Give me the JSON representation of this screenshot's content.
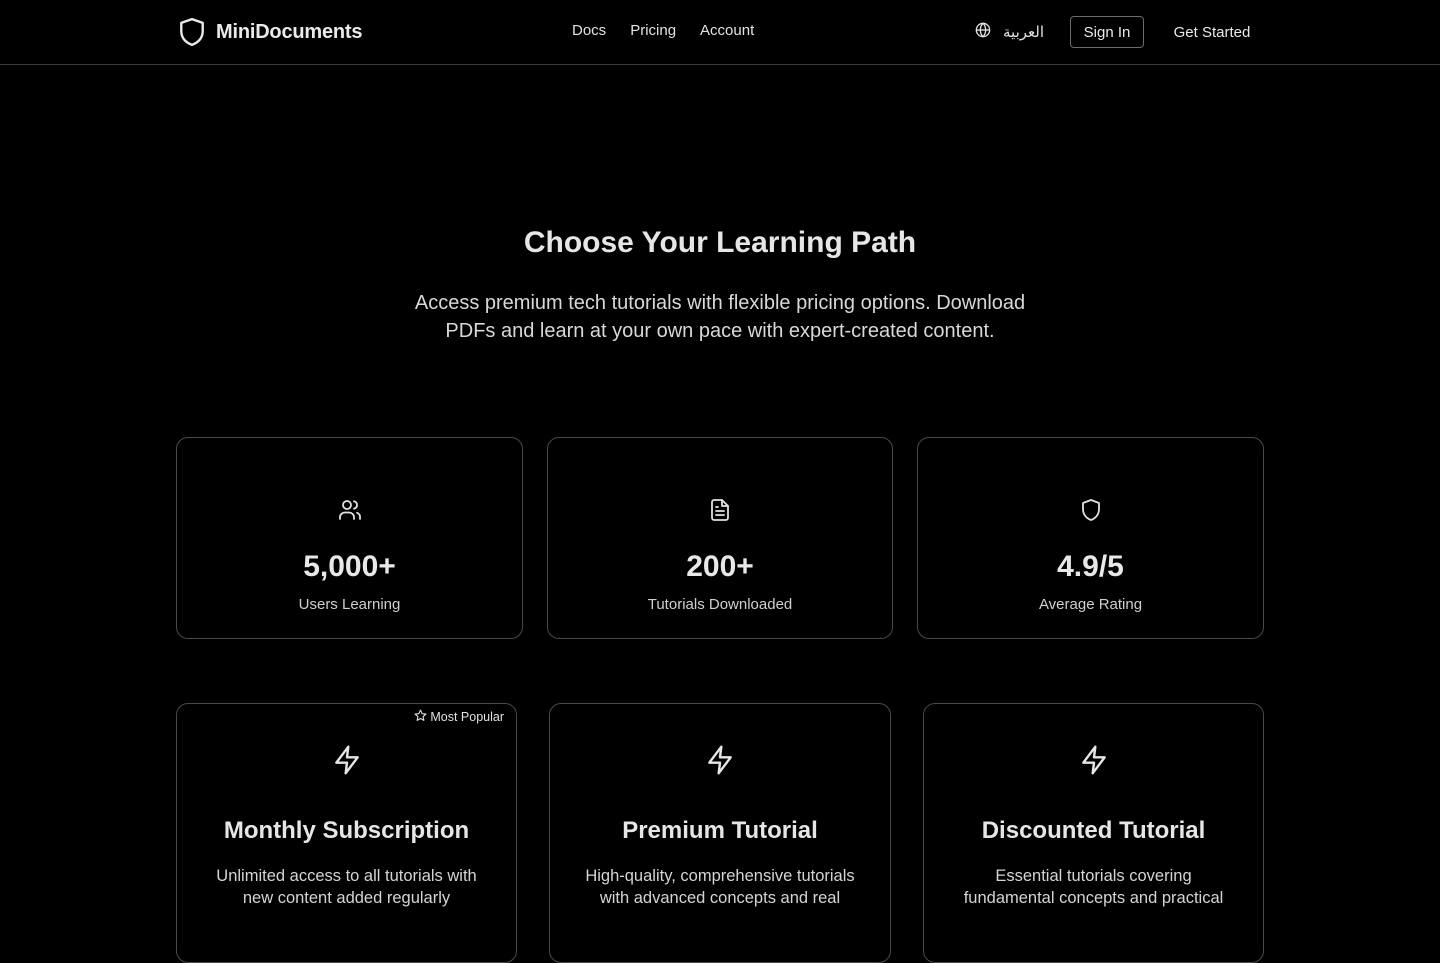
{
  "nav": {
    "brand": "MiniDocuments",
    "links": [
      "Docs",
      "Pricing",
      "Account"
    ],
    "language": "العربية",
    "signin_label": "Sign In",
    "cta_label": "Get Started"
  },
  "hero": {
    "title": "Choose Your Learning Path",
    "subtitle": "Access premium tech tutorials with flexible pricing options. Download PDFs and learn at your own pace with expert-created content."
  },
  "stats": [
    {
      "icon": "users-icon",
      "value": "5,000+",
      "label": "Users Learning"
    },
    {
      "icon": "document-icon",
      "value": "200+",
      "label": "Tutorials Downloaded"
    },
    {
      "icon": "shield-icon",
      "value": "4.9/5",
      "label": "Average Rating"
    }
  ],
  "plans": [
    {
      "icon": "lightning-icon",
      "badge": "Most Popular",
      "title": "Monthly Subscription",
      "description": "Unlimited access to all tutorials with new content added regularly"
    },
    {
      "icon": "lightning-icon",
      "title": "Premium Tutorial",
      "description": "High-quality, comprehensive tutorials with advanced concepts and real"
    },
    {
      "icon": "lightning-icon",
      "title": "Discounted Tutorial",
      "description": "Essential tutorials covering fundamental concepts and practical"
    }
  ],
  "colors": {
    "background": "#000000",
    "border": "#4a4a4a",
    "text": "#ededed"
  }
}
